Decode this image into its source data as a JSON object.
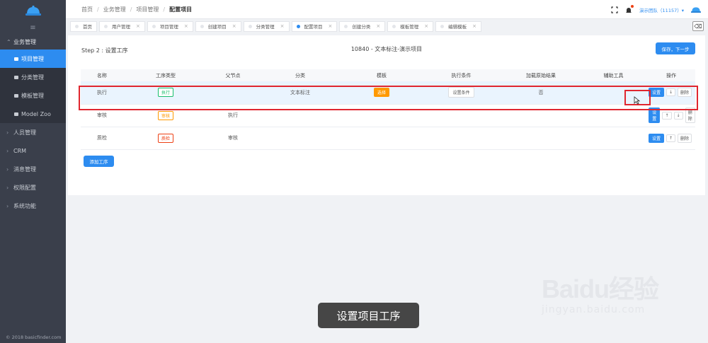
{
  "sidebar": {
    "menu_icon": "menu-icon",
    "group": {
      "label": "业务管理",
      "items": [
        {
          "label": "项目管理",
          "active": true
        },
        {
          "label": "分类管理"
        },
        {
          "label": "模板管理"
        },
        {
          "label": "Model Zoo"
        }
      ]
    },
    "items": [
      {
        "label": "人员管理"
      },
      {
        "label": "CRM"
      },
      {
        "label": "消息管理"
      },
      {
        "label": "权限配置"
      },
      {
        "label": "系统功能"
      }
    ],
    "footer": "© 2018 basicfinder.com"
  },
  "header": {
    "breadcrumb": [
      "首页",
      "业务管理",
      "项目管理",
      "配置项目"
    ],
    "user": "演示团队（11157）▾"
  },
  "tabs": [
    {
      "label": "首页",
      "closable": false
    },
    {
      "label": "用户管理",
      "closable": true
    },
    {
      "label": "项目管理",
      "closable": true
    },
    {
      "label": "创建项目",
      "closable": true
    },
    {
      "label": "分类管理",
      "closable": true
    },
    {
      "label": "配置项目",
      "closable": true,
      "active": true
    },
    {
      "label": "创建分类",
      "closable": true
    },
    {
      "label": "模板管理",
      "closable": true
    },
    {
      "label": "编辑模板",
      "closable": true
    }
  ],
  "content": {
    "step_title": "Step 2 : 设置工序",
    "project_title": "10840 - 文本标注-演示项目",
    "save_next": "保存，下一步",
    "add_process": "添加工序",
    "columns": [
      "名称",
      "工序类型",
      "父节点",
      "分类",
      "模板",
      "执行条件",
      "加载原始结果",
      "辅助工具",
      "操作"
    ],
    "rows": [
      {
        "name": "执行",
        "type": "执行",
        "parent": "",
        "category": "文本标注",
        "template": "选择",
        "condition": "设置条件",
        "load_original": "否",
        "tools": "",
        "set": "设置",
        "down": "↓",
        "delete": "删除"
      },
      {
        "name": "审核",
        "type": "审核",
        "parent": "执行",
        "set": "设置",
        "up": "↑",
        "down": "↓",
        "delete": "删除"
      },
      {
        "name": "质检",
        "type": "质检",
        "parent": "审核",
        "set": "设置",
        "up": "↑",
        "delete": "删除"
      }
    ]
  },
  "caption": "设置项目工序",
  "watermark": {
    "main": "Baidu经验",
    "sub": "jingyan.baidu.com"
  }
}
